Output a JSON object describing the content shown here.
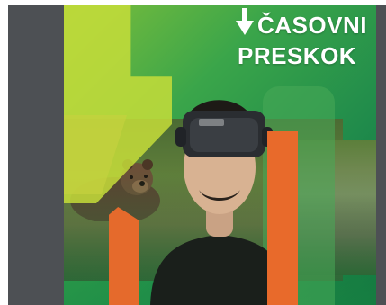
{
  "poster": {
    "title_line_1": "ČASOVNI",
    "title_line_2": "PRESKOK"
  },
  "icons": {
    "title_arrow": "down-arrow-icon",
    "vr_logo": "vr-headset-logo-icon"
  },
  "colors": {
    "frame_bg": "#4d5054",
    "poster_green": "#1f8a4b",
    "accent_yellow": "#c6dd3a",
    "accent_orange": "#e56a2c",
    "title_text": "#ffffff"
  }
}
